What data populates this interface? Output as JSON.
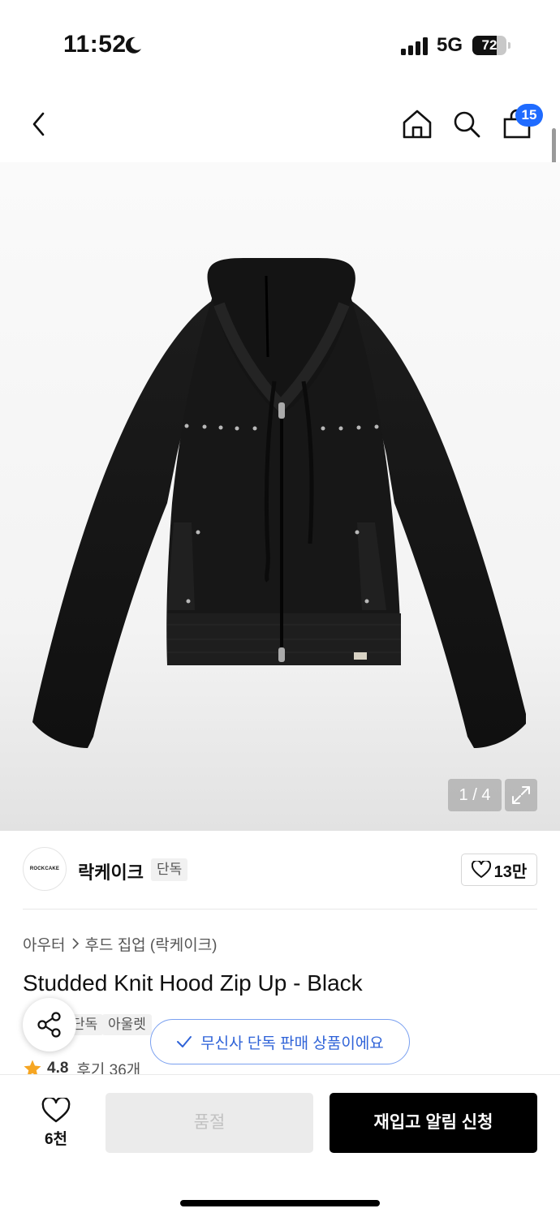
{
  "status_bar": {
    "time": "11:52",
    "network": "5G",
    "battery": "72",
    "battery_level": 0.72
  },
  "nav": {
    "icons": [
      "back-icon",
      "home-icon",
      "search-icon",
      "shopping-bag-icon"
    ],
    "cart_count": "15"
  },
  "gallery": {
    "page_indicator": "1 / 4",
    "current_page": 1,
    "total_pages": 4
  },
  "brand": {
    "logo_text": "ROCKCAKE",
    "name": "락케이크",
    "exclusive_tag": "단독",
    "like_count": "13만"
  },
  "product": {
    "breadcrumb": [
      "아우터",
      "후드 집업 (락케이크)"
    ],
    "title": "Studded Knit Hood Zip Up - Black",
    "tags": [
      "단독",
      "아울렛"
    ],
    "exclusive_notice": "무신사 단독 판매 상품이에요",
    "rating": "4.8",
    "review_label": "후기 36개"
  },
  "bottom_bar": {
    "wish_count": "6천",
    "soldout_label": "품절",
    "restock_label": "재입고 알림 신청"
  },
  "colors": {
    "accent_blue": "#1f6bff",
    "notice_blue": "#2f63d8",
    "star": "#f6a623",
    "primary_button": "#000000",
    "disabled_button": "#ebebeb"
  }
}
